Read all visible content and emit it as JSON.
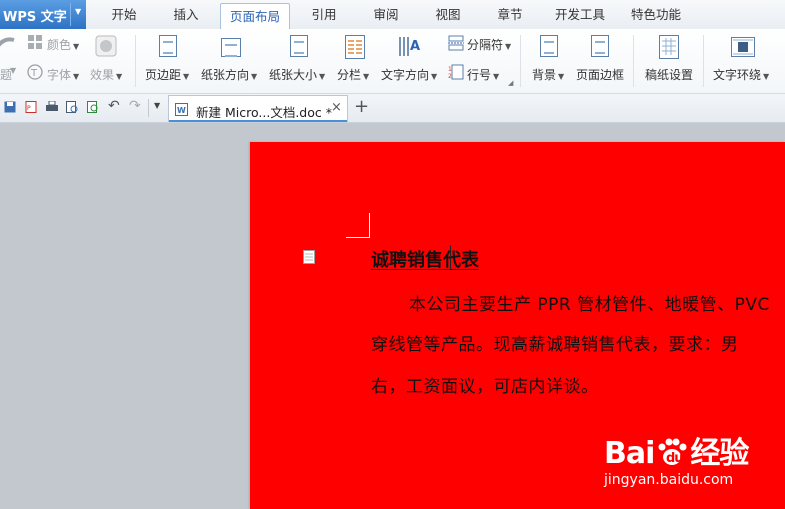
{
  "menubar": {
    "app_name": "WPS 文字",
    "tabs": [
      "开始",
      "插入",
      "页面布局",
      "引用",
      "审阅",
      "视图",
      "章节",
      "开发工具",
      "特色功能"
    ],
    "active_tab": "页面布局"
  },
  "ribbon": {
    "theme_left": "题",
    "color_label": "颜色",
    "font_label": "字体",
    "effect_label": "效果",
    "margins": "页边距",
    "orientation": "纸张方向",
    "size": "纸张大小",
    "columns": "分栏",
    "text_direction": "文字方向",
    "separator": "分隔符",
    "line_numbers": "行号",
    "background": "背景",
    "page_border": "页面边框",
    "manuscript": "稿纸设置",
    "text_wrap": "文字环绕"
  },
  "quickbar": {
    "doc_tab_label": "新建 Micro...文档.doc *",
    "close": "×",
    "new_tab": "+"
  },
  "document": {
    "title": "诚聘销售代表",
    "line1": "本公司主要生产 PPR 管材管件、地暖管、PVC",
    "line2": "穿线管等产品。现高薪诚聘销售代表，要求：男",
    "line3": "右，工资面议，可店内详谈。",
    "page_color": "#ff0000"
  },
  "watermark": {
    "brand": "Bai",
    "brand_cn": "经验",
    "url": "jingyan.baidu.com"
  }
}
